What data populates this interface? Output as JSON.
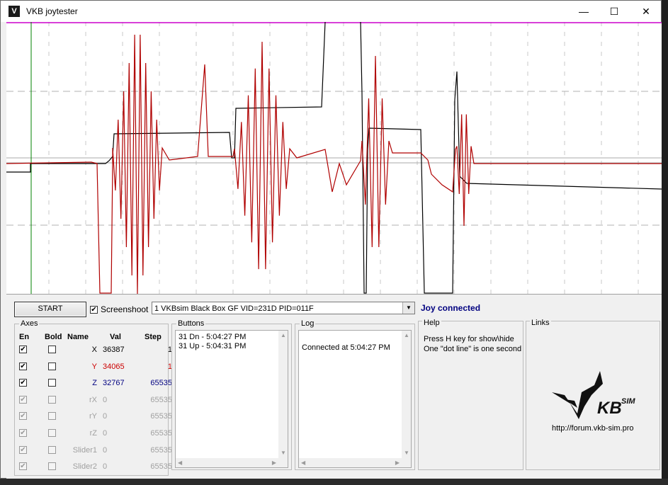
{
  "window": {
    "title": "VKB joytester",
    "minimize_glyph": "—",
    "maximize_glyph": "☐",
    "close_glyph": "✕"
  },
  "toolbar": {
    "start_label": "START",
    "screenshoot_label": "Screenshoot",
    "screenshoot_checked": true,
    "device": "1 VKBsim Black Box GF  VID=231D PID=011F",
    "status": "Joy connected"
  },
  "axes": {
    "title": "Axes",
    "headers": {
      "en": "En",
      "bold": "Bold",
      "name": "Name",
      "val": "Val",
      "step": "Step"
    },
    "rows": [
      {
        "name": "X",
        "val": "36387",
        "step": "1",
        "enabled": true,
        "bold": false,
        "color": "#000000"
      },
      {
        "name": "Y",
        "val": "34065",
        "step": "1",
        "enabled": true,
        "bold": false,
        "color": "#cc0000"
      },
      {
        "name": "Z",
        "val": "32767",
        "step": "65535",
        "enabled": true,
        "bold": false,
        "color": "#000080"
      },
      {
        "name": "rX",
        "val": "0",
        "step": "65535",
        "enabled": true,
        "bold": false,
        "color": "#a0a0a0"
      },
      {
        "name": "rY",
        "val": "0",
        "step": "65535",
        "enabled": true,
        "bold": false,
        "color": "#a0a0a0"
      },
      {
        "name": "rZ",
        "val": "0",
        "step": "65535",
        "enabled": true,
        "bold": false,
        "color": "#a0a0a0"
      },
      {
        "name": "Slider1",
        "val": "0",
        "step": "65535",
        "enabled": true,
        "bold": false,
        "color": "#a0a0a0"
      },
      {
        "name": "Slider2",
        "val": "0",
        "step": "65535",
        "enabled": true,
        "bold": false,
        "color": "#a0a0a0"
      }
    ]
  },
  "buttons": {
    "title": "Buttons",
    "entries": [
      "31 Dn - 5:04:27 PM",
      "31 Up - 5:04:31 PM"
    ]
  },
  "log": {
    "title": "Log",
    "entries": [
      "Connected at 5:04:27 PM"
    ]
  },
  "help": {
    "title": "Help",
    "line1": "Press H key for show\\hide",
    "line2": "One \"dot line\" is one second"
  },
  "links": {
    "title": "Links",
    "logo_text": "VKBsim",
    "url": "http://forum.vkb-sim.pro"
  },
  "colors": {
    "axis_x": "#000000",
    "axis_y": "#b00000",
    "top_line": "#cc00cc",
    "cursor": "#008000",
    "status": "#000080"
  }
}
